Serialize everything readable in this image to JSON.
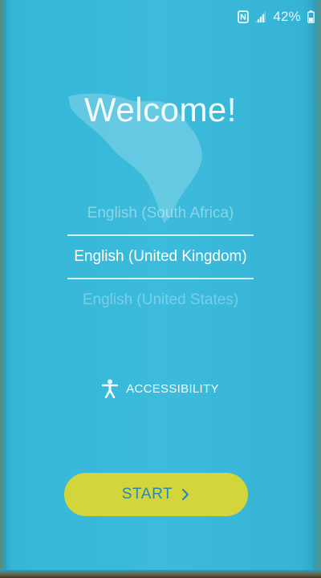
{
  "status_bar": {
    "battery_percent": "42%",
    "icons": [
      "nfc-icon",
      "signal-icon",
      "battery-icon"
    ]
  },
  "welcome": {
    "title": "Welcome!"
  },
  "languages": {
    "items": [
      "English (South Africa)",
      "English (United Kingdom)",
      "English (United States)"
    ],
    "selected": "English (United Kingdom)"
  },
  "accessibility": {
    "label": "ACCESSIBILITY",
    "icon": "accessibility-icon"
  },
  "start_button": {
    "label": "START",
    "icon": "chevron-right-icon"
  },
  "colors": {
    "background": "#3cbbdc",
    "button": "#d2d63a",
    "button_text": "#2a86b3",
    "text": "#ffffff"
  }
}
